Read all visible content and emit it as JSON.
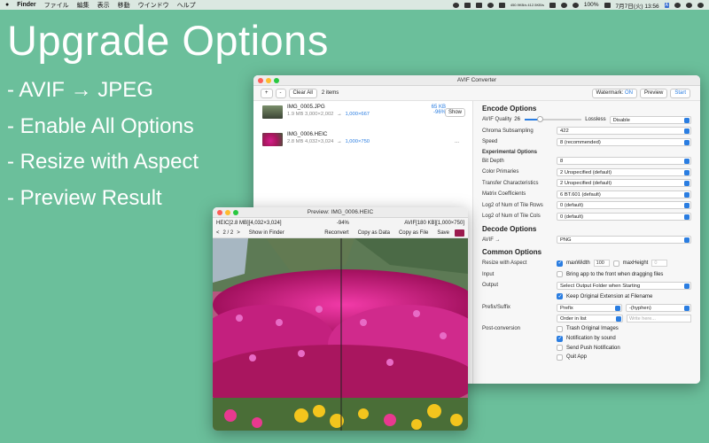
{
  "menubar": {
    "app": "Finder",
    "items": [
      "ファイル",
      "編集",
      "表示",
      "移動",
      "ウインドウ",
      "ヘルプ"
    ],
    "net": "450.9KB/s 412.5KB/s",
    "battery": "100%",
    "clock": "7月7日(火) 13:56",
    "input_mode": "A"
  },
  "promo": {
    "title": "Upgrade Options",
    "items": [
      "- AVIF → JPEG",
      "- Enable All Options",
      "- Resize with Aspect",
      "- Preview Result"
    ]
  },
  "converter": {
    "title": "AVIF Converter",
    "toolbar": {
      "add": "+",
      "remove": "-",
      "clear_all": "Clear All",
      "count": "2 items",
      "watermark_label": "Watermark:",
      "watermark_value": "ON",
      "preview": "Preview",
      "start": "Start"
    },
    "files": [
      {
        "name": "IMG_0005.JPG",
        "size": "1.9 MB",
        "dims": "3,000×2,002",
        "arrow": "→",
        "new_dims": "1,000×667",
        "out_size": "65 KB",
        "ratio": "-96%",
        "action": "Show"
      },
      {
        "name": "IMG_0006.HEIC",
        "size": "2.8 MB",
        "dims": "4,032×3,024",
        "arrow": "→",
        "new_dims": "1,000×750",
        "more": "..."
      }
    ],
    "encode": {
      "heading": "Encode Options",
      "quality_label": "AVIF Quality",
      "quality_value": "26",
      "quality_fraction": 0.26,
      "lossless_label": "Lossless",
      "lossless_value": "Disable",
      "chroma_label": "Chroma Subsampling",
      "chroma_value": "422",
      "speed_label": "Speed",
      "speed_value": "8 (recommended)",
      "experimental_heading": "Experimental Options",
      "bit_depth_label": "Bit Depth",
      "bit_depth_value": "8",
      "color_primaries_label": "Color Primaries",
      "color_primaries_value": "2  Unspecified (default)",
      "transfer_label": "Transfer Characteristics",
      "transfer_value": "2  Unspecified (default)",
      "matrix_label": "Matrix Coefficients",
      "matrix_value": "6  BT.601 (default)",
      "tile_rows_label": "Log2 of Num of Tile Rows",
      "tile_rows_value": "0 (default)",
      "tile_cols_label": "Log2 of Num of Tile Cols",
      "tile_cols_value": "0 (default)"
    },
    "decode": {
      "heading": "Decode Options",
      "avif_label": "AVIF →",
      "avif_value": "PNG"
    },
    "common": {
      "heading": "Common Options",
      "resize_label": "Resize with Aspect",
      "max_width_label": "maxWidth",
      "max_width_value": "100",
      "max_height_label": "maxHeight",
      "max_height_value": "0",
      "input_label": "Input",
      "input_option": "Bring app to the front when dragging files",
      "output_label": "Output",
      "output_value": "Select Output Folder when Starting",
      "keep_ext_label": "Keep Original Extension at Filename",
      "prefix_label": "Prefix/Suffix",
      "prefix_value": "Prefix",
      "hyphen_value": "-(hyphen)",
      "order_value": "Order in list",
      "write_here_placeholder": "Write here...",
      "post_label": "Post-conversion",
      "trash_label": "Trash Original Images",
      "notify_sound_label": "Notification by sound",
      "push_label": "Send Push Notification",
      "quit_label": "Quit App"
    }
  },
  "preview": {
    "title": "Preview: IMG_0006.HEIC",
    "left_info": "HEIC[2.8 MB][4,032×3,024]",
    "ratio": "-94%",
    "right_info": "AVIF[180 KB][1,000×750]",
    "prev": "<",
    "page": "2 / 2",
    "next": ">",
    "show_in_finder": "Show in Finder",
    "reconvert": "Reconvert",
    "copy_as_data": "Copy as Data",
    "copy_as_file": "Copy as File",
    "save": "Save"
  }
}
